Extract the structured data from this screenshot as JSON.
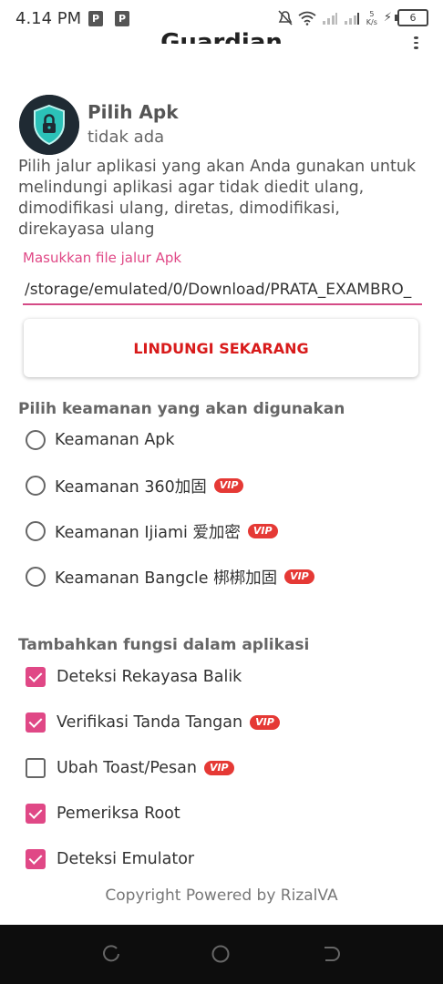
{
  "status_bar": {
    "time": "4.14 PM",
    "sim1": "P",
    "sim2": "P",
    "net_speed": "5 K/s",
    "battery": "6"
  },
  "header": {
    "title": "Guardian"
  },
  "apk": {
    "title": "Pilih Apk",
    "subtitle": "tidak ada",
    "description": "Pilih jalur aplikasi yang akan Anda gunakan untuk melindungi aplikasi agar tidak diedit ulang, dimodifikasi ulang, diretas, dimodifikasi, direkayasa ulang"
  },
  "path_field": {
    "label": "Masukkan file jalur Apk",
    "value": "/storage/emulated/0/Download/PRATA_EXAMBRO_"
  },
  "protect_button": {
    "label": "LINDUNGI SEKARANG"
  },
  "security_section": {
    "title": "Pilih keamanan yang akan digunakan",
    "options": [
      {
        "label": "Keamanan Apk",
        "vip": ""
      },
      {
        "label": "Keamanan 360加固",
        "vip": "VIP"
      },
      {
        "label": "Keamanan Ijiami 爱加密",
        "vip": "VIP"
      },
      {
        "label": "Keamanan Bangcle 梆梆加固",
        "vip": "VIP"
      }
    ]
  },
  "functions_section": {
    "title": "Tambahkan fungsi dalam aplikasi",
    "options": [
      {
        "label": "Deteksi Rekayasa Balik",
        "checked": true,
        "vip": ""
      },
      {
        "label": "Verifikasi Tanda Tangan",
        "checked": true,
        "vip": "VIP"
      },
      {
        "label": "Ubah Toast/Pesan",
        "checked": false,
        "vip": "VIP"
      },
      {
        "label": "Pemeriksa Root",
        "checked": true,
        "vip": ""
      },
      {
        "label": "Deteksi Emulator",
        "checked": true,
        "vip": ""
      }
    ]
  },
  "footer": {
    "copyright": "Copyright Powered by RizalVA"
  },
  "colors": {
    "accent": "#e04886",
    "button_text": "#d81b1b",
    "vip_badge": "#e53935"
  }
}
